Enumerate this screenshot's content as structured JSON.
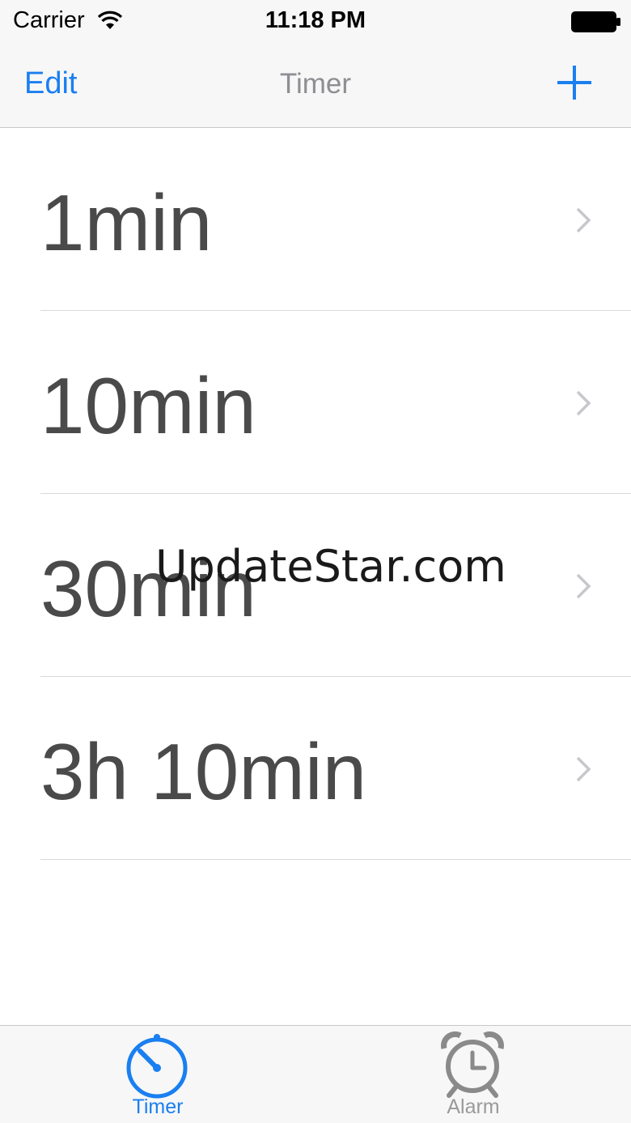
{
  "status_bar": {
    "carrier": "Carrier",
    "time": "11:18 PM"
  },
  "nav": {
    "edit_label": "Edit",
    "title": "Timer"
  },
  "timers": [
    {
      "label": "1min"
    },
    {
      "label": "10min"
    },
    {
      "label": "30min"
    },
    {
      "label": "3h 10min"
    }
  ],
  "watermark": "UpdateStar.com",
  "tab_bar": {
    "tabs": [
      {
        "label": "Timer",
        "icon": "stopwatch-icon",
        "active": true
      },
      {
        "label": "Alarm",
        "icon": "alarm-clock-icon",
        "active": false
      }
    ]
  },
  "colors": {
    "accent": "#1a7ff0",
    "inactive": "#9a9a9a",
    "text": "#4a4a4a",
    "bar_background": "#f7f7f7"
  }
}
